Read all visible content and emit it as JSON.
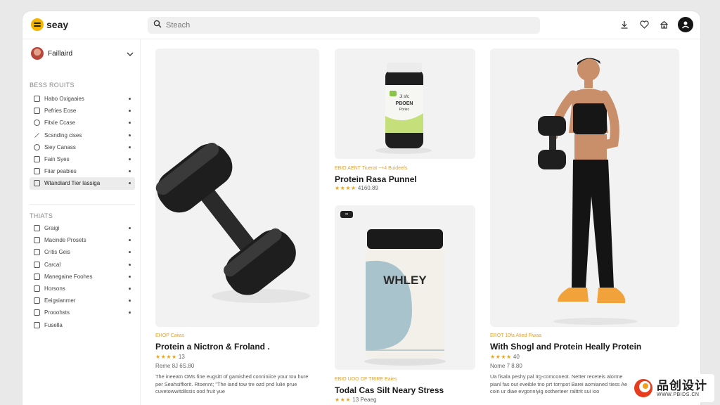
{
  "app": {
    "name": "seay"
  },
  "search": {
    "placeholder": "Steach"
  },
  "profile": {
    "name": "Faillaird"
  },
  "sidebar": {
    "section1_title": "BESS ROUITS",
    "section1_items": [
      {
        "label": "Habo Oxigaaies",
        "active": false
      },
      {
        "label": "Pefries Eose",
        "active": false
      },
      {
        "label": "Fitxie Ccase",
        "active": false
      },
      {
        "label": "Scsnding cises",
        "active": false
      },
      {
        "label": "Siey Canass",
        "active": false
      },
      {
        "label": "Fain Syes",
        "active": false
      },
      {
        "label": "Fiiar peabies",
        "active": false
      },
      {
        "label": "Wtandiard Tier lassiga",
        "active": true
      }
    ],
    "section2_title": "THIATS",
    "section2_items": [
      {
        "label": "Graigi"
      },
      {
        "label": "Macinde Prosets"
      },
      {
        "label": "Critis Geis"
      },
      {
        "label": "Carcal"
      },
      {
        "label": "Manegaine Foohes"
      },
      {
        "label": "Horsons"
      },
      {
        "label": "Eeigsianmer"
      },
      {
        "label": "Prooohsts"
      },
      {
        "label": "Fusella"
      }
    ]
  },
  "products": [
    {
      "eyebrow": "EHOP Caiias",
      "title": "Protein a Nictron & Froland .",
      "stars": "★★★★",
      "rating_text": "13",
      "price_text": "Reme  8J 6S.80",
      "desc": "The ineeatn OMs fine eugsitt of gamished conniniice your tou hure per Seahsiffiorit. Rtoennt; \"The iand tow tre ozd pnd lulie prue cuvetowwitdilssis ood fruit yue"
    },
    {
      "eyebrow": "EBIO AENT Tiuerat ~+4 Buideefs",
      "title": "Protein Rasa Punnel",
      "stars": "★★★★",
      "rating_text": "4160.89"
    },
    {
      "badge": "▪▪",
      "eyebrow": "EBIO UOO OF TRIRE Eaies",
      "title": "Todal Cas Silt Neary Stress",
      "stars": "★★★",
      "rating_text": "13  Peaeg",
      "jar_label": "WHLEY"
    },
    {
      "eyebrow": "EROT 10fa Atied Fiwaa",
      "title": "With Shogl and Protein Heally Protein",
      "stars": "★★★★",
      "rating_text": "40",
      "price_text": "Nome  7 8.80",
      "desc": "Ua fisala peshy pal Irg-comconeot. Netter receteis alorme pianl fas out eveible tno prt tornpot Barei aomianed tiess Ae coin ur diae evgonniyig ootherteer ralttrit sui ioo"
    }
  ],
  "supplement_bottle": {
    "label_line1": "Ji sfc",
    "label_line2": "PBOEN",
    "label_line3": "Poriec"
  },
  "watermark": {
    "cn": "品创设计",
    "url": "WWW.PBIDS.CN"
  },
  "colors": {
    "accent": "#f5b400",
    "star": "#e7a323",
    "eyebrow": "#e0a23a"
  }
}
